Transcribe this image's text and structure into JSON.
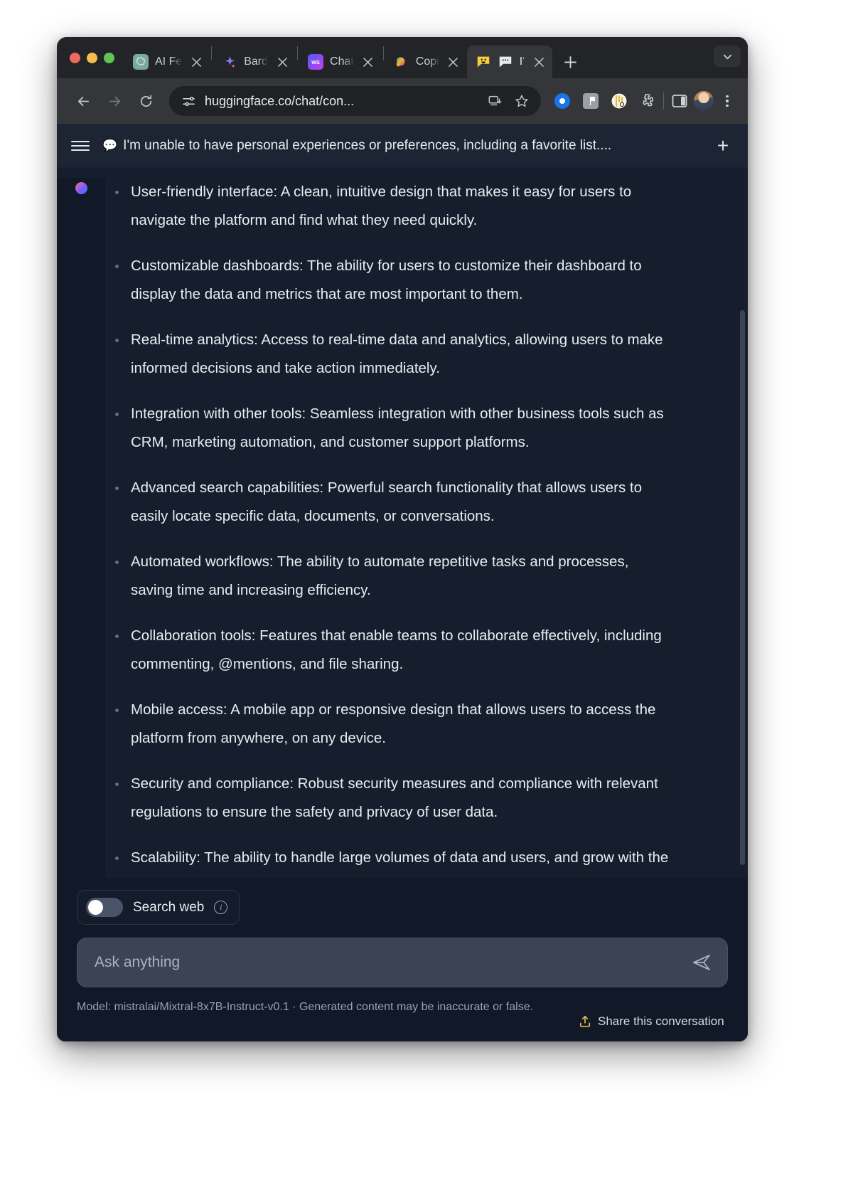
{
  "browser": {
    "traffic_lights": [
      "close",
      "minimize",
      "maximize"
    ],
    "tabs": [
      {
        "label": "AI Fe",
        "favicon": "openai-icon",
        "active": false
      },
      {
        "label": "Bard",
        "favicon": "bard-sparkle-icon",
        "active": false
      },
      {
        "label": "Chat",
        "favicon": "writesonic-icon",
        "active": false
      },
      {
        "label": "Copi",
        "favicon": "copilot-icon",
        "active": false
      },
      {
        "label": "I'",
        "favicon": "huggingchat-smiley-icon",
        "active": true
      }
    ],
    "new_tab_label": "+",
    "tab_list_chevron": "chevron-down-icon",
    "nav": {
      "back": "back-arrow-icon",
      "forward": "forward-arrow-icon",
      "reload": "reload-icon"
    },
    "omnibox": {
      "site_settings_icon": "tune-icon",
      "url": "huggingface.co/chat/con...",
      "install_icon": "install-app-icon",
      "bookmark_icon": "star-icon"
    },
    "extensions": [
      "blue-record-icon",
      "gray-panel-icon",
      "yellow-circle-icon",
      "puzzle-extensions-icon"
    ],
    "side_panel_icon": "split-panel-icon",
    "profile_avatar": "user-avatar",
    "menu_icon": "kebab-menu-icon"
  },
  "chat": {
    "menu_icon": "hamburger-menu-icon",
    "title_emoji": "💬",
    "title": "I'm unable to have personal experiences or preferences, including a favorite list....",
    "new_chat_icon": "plus-icon",
    "assistant_avatar": "gradient-orb-avatar",
    "bullets": [
      "User-friendly interface: A clean, intuitive design that makes it easy for users to navigate the platform and find what they need quickly.",
      "Customizable dashboards: The ability for users to customize their dashboard to display the data and metrics that are most important to them.",
      "Real-time analytics: Access to real-time data and analytics, allowing users to make informed decisions and take action immediately.",
      "Integration with other tools: Seamless integration with other business tools such as CRM, marketing automation, and customer support platforms.",
      "Advanced search capabilities: Powerful search functionality that allows users to easily locate specific data, documents, or conversations.",
      "Automated workflows: The ability to automate repetitive tasks and processes, saving time and increasing efficiency.",
      "Collaboration tools: Features that enable teams to collaborate effectively, including commenting, @mentions, and file sharing.",
      "Mobile access: A mobile app or responsive design that allows users to access the platform from anywhere, on any device.",
      "Security and compliance: Robust security measures and compliance with relevant regulations to ensure the safety and privacy of user data.",
      "Scalability: The ability to handle large volumes of data and users, and grow with the needs of the organization."
    ]
  },
  "composer": {
    "search_web_label": "Search web",
    "search_web_enabled": false,
    "info_icon": "info-icon",
    "input_placeholder": "Ask anything",
    "input_value": "",
    "send_icon": "send-paper-plane-icon"
  },
  "footer": {
    "model_note": "Model: mistralai/Mixtral-8x7B-Instruct-v0.1 · Generated content may be inaccurate or false.",
    "share_label": "Share this conversation",
    "share_icon": "share-upload-icon",
    "share_icon_color": "#e8b84b"
  }
}
